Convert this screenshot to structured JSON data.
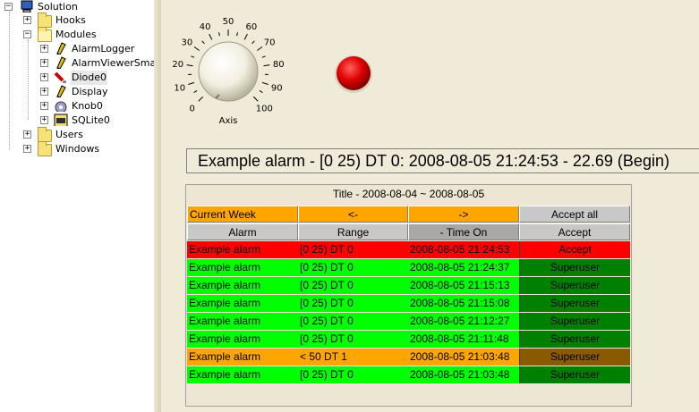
{
  "tree": {
    "root": "Solution",
    "items": [
      {
        "label": "Hooks"
      },
      {
        "label": "Modules"
      },
      {
        "label": "AlarmLogger"
      },
      {
        "label": "AlarmViewerSmall"
      },
      {
        "label": "Diode0"
      },
      {
        "label": "Display"
      },
      {
        "label": "Knob0"
      },
      {
        "label": "SQLite0"
      },
      {
        "label": "Users"
      },
      {
        "label": "Windows"
      }
    ]
  },
  "knob": {
    "ticks": [
      "0",
      "10",
      "20",
      "30",
      "40",
      "50",
      "60",
      "70",
      "80",
      "90",
      "100"
    ],
    "axis_label": "Axis"
  },
  "alarm_display": "Example alarm - [0 25) DT 0: 2008-08-05 21:24:53 - 22.69 (Begin)",
  "viewer": {
    "title": "Title -  2008-08-04 ~ 2008-08-05",
    "nav": {
      "period": "Current Week",
      "prev": "<-",
      "next": "->",
      "accept_all": "Accept all"
    },
    "columns": [
      "Alarm",
      "Range",
      "- Time On",
      "Accept"
    ],
    "rows": [
      {
        "alarm": "Example alarm",
        "range": "[0 25) DT 0",
        "time": "2008-08-05 21:24:53",
        "accept": "Accept",
        "bg": "#ff0000",
        "accept_bg": "#ff0000"
      },
      {
        "alarm": "Example alarm",
        "range": "[0 25) DT 0",
        "time": "2008-08-05 21:24:37",
        "accept": "Superuser",
        "bg": "#00ff00",
        "accept_bg": "#008000"
      },
      {
        "alarm": "Example alarm",
        "range": "[0 25) DT 0",
        "time": "2008-08-05 21:15:13",
        "accept": "Superuser",
        "bg": "#00ff00",
        "accept_bg": "#008000"
      },
      {
        "alarm": "Example alarm",
        "range": "[0 25) DT 0",
        "time": "2008-08-05 21:15:08",
        "accept": "Superuser",
        "bg": "#00ff00",
        "accept_bg": "#008000"
      },
      {
        "alarm": "Example alarm",
        "range": "[0 25) DT 0",
        "time": "2008-08-05 21:12:27",
        "accept": "Superuser",
        "bg": "#00ff00",
        "accept_bg": "#008000"
      },
      {
        "alarm": "Example alarm",
        "range": "[0 25) DT 0",
        "time": "2008-08-05 21:11:48",
        "accept": "Superuser",
        "bg": "#00ff00",
        "accept_bg": "#008000"
      },
      {
        "alarm": "Example alarm",
        "range": "< 50 DT 1",
        "time": "2008-08-05 21:03:48",
        "accept": "Superuser",
        "bg": "#ffa500",
        "accept_bg": "#8a5a00"
      },
      {
        "alarm": "Example alarm",
        "range": "[0 25) DT 0",
        "time": "2008-08-05 21:03:48",
        "accept": "Superuser",
        "bg": "#00ff00",
        "accept_bg": "#008000"
      }
    ]
  },
  "colors": {
    "panel": "#f0ebd8",
    "nav_orange": "#ffa500",
    "header_gray": "#c8c8c8",
    "diode": "#ff0000"
  }
}
